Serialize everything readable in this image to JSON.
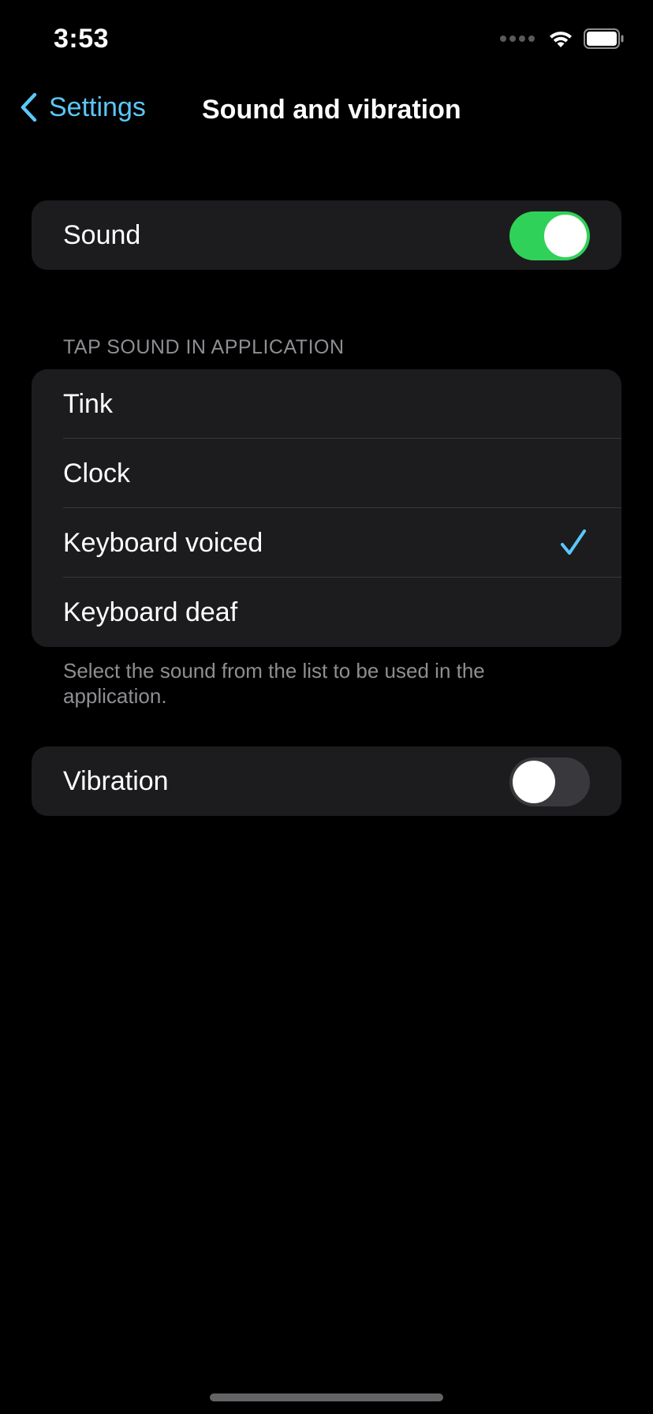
{
  "status_bar": {
    "time": "3:53"
  },
  "nav": {
    "back_label": "Settings",
    "title": "Sound and vibration"
  },
  "sound": {
    "label": "Sound",
    "enabled": true
  },
  "tap_sound": {
    "header": "TAP SOUND IN APPLICATION",
    "options": [
      "Tink",
      "Clock",
      "Keyboard voiced",
      "Keyboard deaf"
    ],
    "selected": "Keyboard voiced",
    "footer": "Select the sound from the list to be used in the application."
  },
  "vibration": {
    "label": "Vibration",
    "enabled": false
  },
  "colors": {
    "accent": "#5ac8fa",
    "toggle_on": "#30d158",
    "toggle_off": "#39393d",
    "group_bg": "#1c1c1e",
    "secondary_text": "#8e8e93"
  },
  "icons": {
    "back": "chevron-left-icon",
    "selected": "checkmark-icon",
    "signal": "cellular-signal-icon",
    "wifi": "wifi-icon",
    "battery": "battery-icon"
  }
}
